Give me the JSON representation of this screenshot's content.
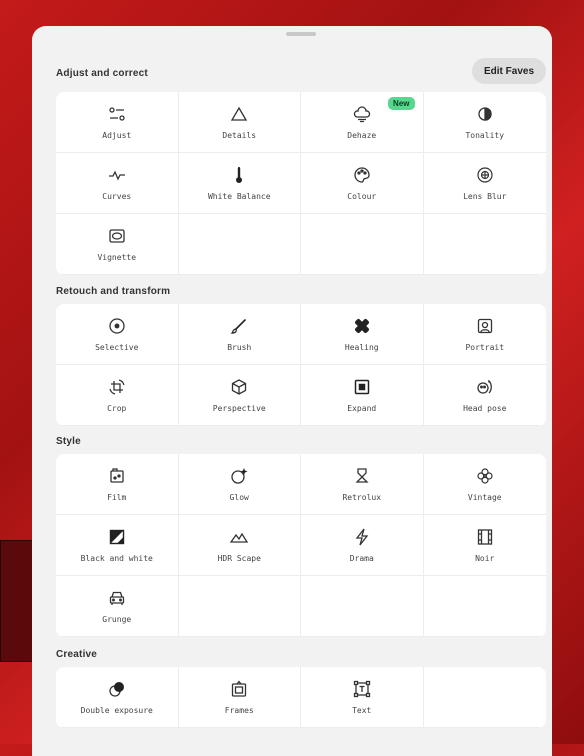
{
  "header": {
    "edit_faves": "Edit Faves"
  },
  "sections": [
    {
      "title": "Adjust and correct",
      "tools": [
        {
          "label": "Adjust",
          "icon": "sliders-icon"
        },
        {
          "label": "Details",
          "icon": "triangle-icon"
        },
        {
          "label": "Dehaze",
          "icon": "cloud-sun-icon",
          "badge": "New"
        },
        {
          "label": "Tonality",
          "icon": "tonality-icon"
        },
        {
          "label": "Curves",
          "icon": "curves-icon"
        },
        {
          "label": "White Balance",
          "icon": "thermometer-icon"
        },
        {
          "label": "Colour",
          "icon": "palette-icon"
        },
        {
          "label": "Lens Blur",
          "icon": "lens-blur-icon"
        },
        {
          "label": "Vignette",
          "icon": "vignette-icon"
        }
      ]
    },
    {
      "title": "Retouch and transform",
      "tools": [
        {
          "label": "Selective",
          "icon": "target-icon"
        },
        {
          "label": "Brush",
          "icon": "brush-icon"
        },
        {
          "label": "Healing",
          "icon": "bandage-icon"
        },
        {
          "label": "Portrait",
          "icon": "portrait-icon"
        },
        {
          "label": "Crop",
          "icon": "crop-rotate-icon"
        },
        {
          "label": "Perspective",
          "icon": "cube-icon"
        },
        {
          "label": "Expand",
          "icon": "expand-icon"
        },
        {
          "label": "Head pose",
          "icon": "head-pose-icon"
        }
      ]
    },
    {
      "title": "Style",
      "tools": [
        {
          "label": "Film",
          "icon": "film-icon"
        },
        {
          "label": "Glow",
          "icon": "glow-icon"
        },
        {
          "label": "Retrolux",
          "icon": "retrolux-icon"
        },
        {
          "label": "Vintage",
          "icon": "flower-icon"
        },
        {
          "label": "Black and white",
          "icon": "black-white-icon"
        },
        {
          "label": "HDR Scape",
          "icon": "mountains-icon"
        },
        {
          "label": "Drama",
          "icon": "lightning-icon"
        },
        {
          "label": "Noir",
          "icon": "film-strip-icon"
        },
        {
          "label": "Grunge",
          "icon": "car-icon"
        }
      ]
    },
    {
      "title": "Creative",
      "tools": [
        {
          "label": "Double exposure",
          "icon": "double-exposure-icon"
        },
        {
          "label": "Frames",
          "icon": "frame-icon"
        },
        {
          "label": "Text",
          "icon": "text-icon"
        }
      ]
    }
  ]
}
